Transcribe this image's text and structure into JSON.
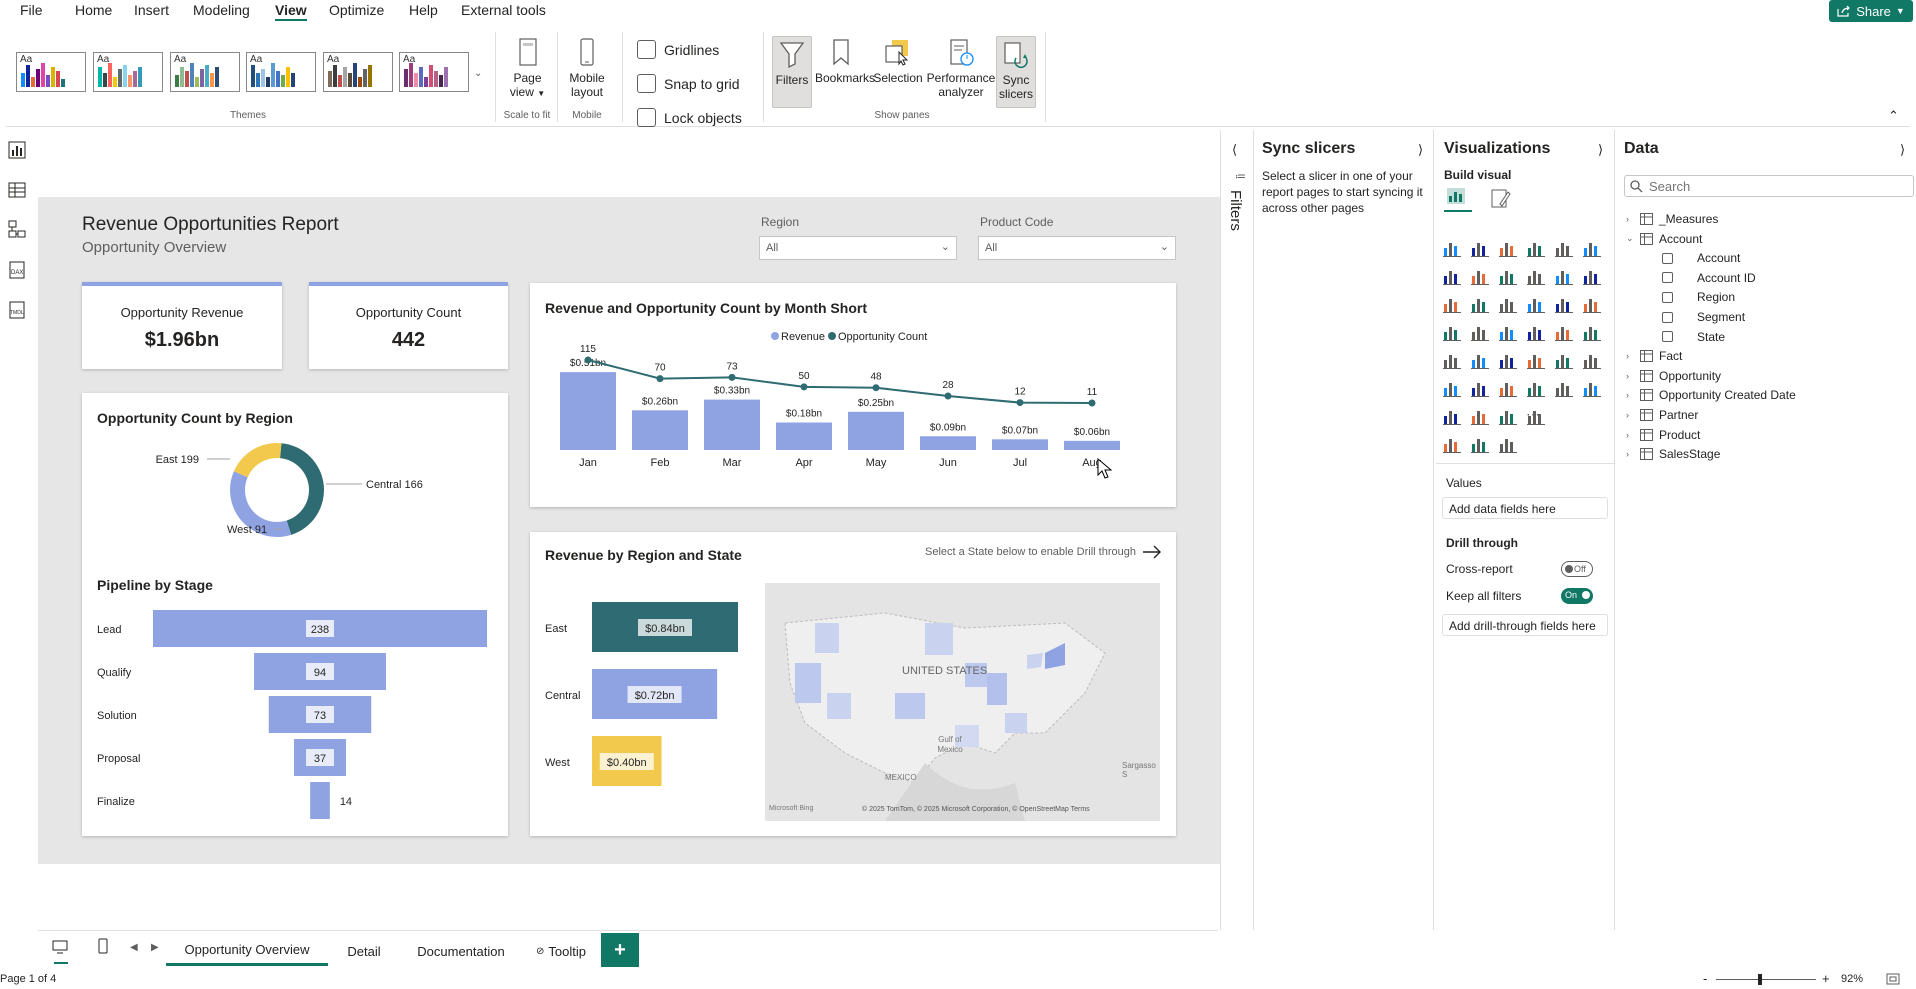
{
  "menu": [
    "File",
    "Home",
    "Insert",
    "Modeling",
    "View",
    "Optimize",
    "Help",
    "External tools"
  ],
  "share_label": "Share",
  "ribbon": {
    "themes_label": "Themes",
    "page_view_label": "Page view",
    "scale_to_fit_label": "Scale to fit",
    "mobile_layout_label": "Mobile layout",
    "mobile_label": "Mobile",
    "gridlines_label": "Gridlines",
    "snap_label": "Snap to grid",
    "lock_label": "Lock objects",
    "filters_label": "Filters",
    "bookmarks_label": "Bookmarks",
    "selection_label": "Selection",
    "performance_label": "Performance analyzer",
    "sync_label": "Sync slicers",
    "show_panes_label": "Show panes",
    "theme_thumb_label": "Aa"
  },
  "report": {
    "title": "Revenue Opportunities Report",
    "subtitle": "Opportunity Overview",
    "slicer_region_label": "Region",
    "slicer_region_value": "All",
    "slicer_product_label": "Product Code",
    "slicer_product_value": "All",
    "kpi_revenue_label": "Opportunity Revenue",
    "kpi_revenue_value": "$1.96bn",
    "kpi_count_label": "Opportunity Count",
    "kpi_count_value": "442",
    "donut_title": "Opportunity Count by Region",
    "funnel_title": "Pipeline by Stage",
    "combo_title": "Revenue and Opportunity Count by Month Short",
    "map_title": "Revenue by Region and State",
    "map_hint": "Select a State below to enable Drill through",
    "map_label_us": "UNITED STATES",
    "map_label_gulf": "Gulf of Mexico",
    "map_label_mexico": "MEXICO",
    "map_label_sargasso": "Sargasso S",
    "map_credit": "© 2025 TomTom, © 2025 Microsoft Corporation, © OpenStreetMap Terms",
    "map_bing": "Microsoft Bing"
  },
  "chart_data": [
    {
      "type": "donut",
      "title": "Opportunity Count by Region",
      "categories": [
        "East",
        "Central",
        "West"
      ],
      "values": [
        199,
        166,
        91
      ],
      "colors": [
        "#2f6b72",
        "#8fa3e3",
        "#f2c94c"
      ]
    },
    {
      "type": "bar",
      "title": "Pipeline by Stage",
      "categories": [
        "Lead",
        "Qualify",
        "Solution",
        "Proposal",
        "Finalize"
      ],
      "values": [
        238,
        94,
        73,
        37,
        14
      ],
      "color": "#8fa3e3"
    },
    {
      "type": "bar+line",
      "title": "Revenue and Opportunity Count by Month Short",
      "legend": [
        "Revenue",
        "Opportunity Count"
      ],
      "categories": [
        "Jan",
        "Feb",
        "Mar",
        "Apr",
        "May",
        "Jun",
        "Jul",
        "Aug"
      ],
      "series": [
        {
          "name": "Revenue",
          "values": [
            0.51,
            0.26,
            0.33,
            0.18,
            0.25,
            0.09,
            0.07,
            0.06
          ],
          "labels": [
            "$0.51bn",
            "$0.26bn",
            "$0.33bn",
            "$0.18bn",
            "$0.25bn",
            "$0.09bn",
            "$0.07bn",
            "$0.06bn"
          ],
          "color": "#8fa3e3"
        },
        {
          "name": "Opportunity Count",
          "values": [
            115,
            70,
            73,
            50,
            48,
            28,
            12,
            11
          ],
          "color": "#2f6b72"
        }
      ]
    },
    {
      "type": "bar",
      "title": "Revenue by Region and State",
      "categories": [
        "East",
        "Central",
        "West"
      ],
      "values": [
        0.84,
        0.72,
        0.4
      ],
      "labels": [
        "$0.84bn",
        "$0.72bn",
        "$0.40bn"
      ],
      "colors": [
        "#2f6b72",
        "#8fa3e3",
        "#f2c94c"
      ]
    }
  ],
  "filters_tab_label": "Filters",
  "sync_pane": {
    "title": "Sync slicers",
    "text_line1": "Select a slicer in one of your",
    "text_line2": "report pages to start syncing it",
    "text_line3": "across other pages"
  },
  "viz_pane": {
    "title": "Visualizations",
    "build_label": "Build visual",
    "values_label": "Values",
    "add_data_label": "Add data fields here",
    "drill_label": "Drill through",
    "cross_report_label": "Cross-report",
    "cross_report_state": "Off",
    "keep_filters_label": "Keep all filters",
    "keep_filters_state": "On",
    "add_drill_label": "Add drill-through fields here"
  },
  "data_pane": {
    "title": "Data",
    "search_placeholder": "Search",
    "tables": [
      "_Measures",
      "Account",
      "Fact",
      "Opportunity",
      "Opportunity Created Date",
      "Partner",
      "Product",
      "SalesStage"
    ],
    "account_fields": [
      "Account",
      "Account ID",
      "Region",
      "Segment",
      "State"
    ]
  },
  "tabs": [
    "Opportunity Overview",
    "Detail",
    "Documentation",
    "Tooltip"
  ],
  "add_tab": "+",
  "status": {
    "page": "Page 1 of 4",
    "zoom": "92%",
    "minus": "-",
    "plus": "+"
  }
}
